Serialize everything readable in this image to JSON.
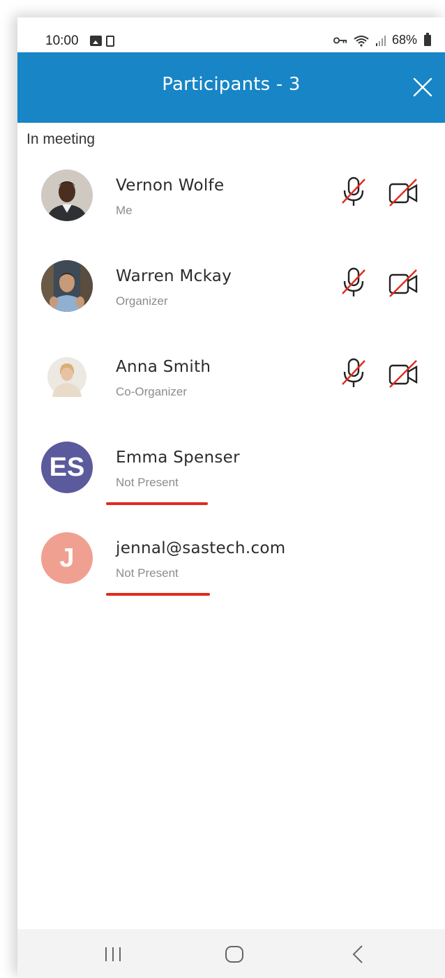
{
  "status_bar": {
    "time": "10:00",
    "battery": "68%"
  },
  "header": {
    "title": "Participants - 3"
  },
  "section": {
    "label": "In meeting"
  },
  "participants": [
    {
      "name": "Vernon Wolfe",
      "role": "Me",
      "avatar_type": "photo",
      "avatar_bg": "#3a3a3a",
      "mic_muted": true,
      "camera_off": true
    },
    {
      "name": "Warren Mckay",
      "role": "Organizer",
      "avatar_type": "photo",
      "avatar_bg": "#4a5d6e",
      "mic_muted": true,
      "camera_off": true
    },
    {
      "name": "Anna Smith",
      "role": "Co-Organizer",
      "avatar_type": "photo",
      "avatar_bg": "#e8e2da",
      "mic_muted": true,
      "camera_off": true
    },
    {
      "name": "Emma Spenser",
      "role": "Not Present",
      "avatar_type": "initials",
      "initials": "ES",
      "avatar_bg": "#5b5a9c"
    },
    {
      "name": "jennal@sastech.com",
      "role": "Not Present",
      "avatar_type": "initials",
      "initials": "J",
      "avatar_bg": "#f0a090"
    }
  ],
  "colors": {
    "header_bg": "#1785c6",
    "underline": "#e02a1c",
    "muted_slash": "#e02a1c"
  },
  "icons": {
    "mic": "mic-muted-icon",
    "camera": "camera-off-icon",
    "close": "close-icon",
    "nav_recent": "recent-apps-icon",
    "nav_home": "home-icon",
    "nav_back": "back-icon"
  }
}
